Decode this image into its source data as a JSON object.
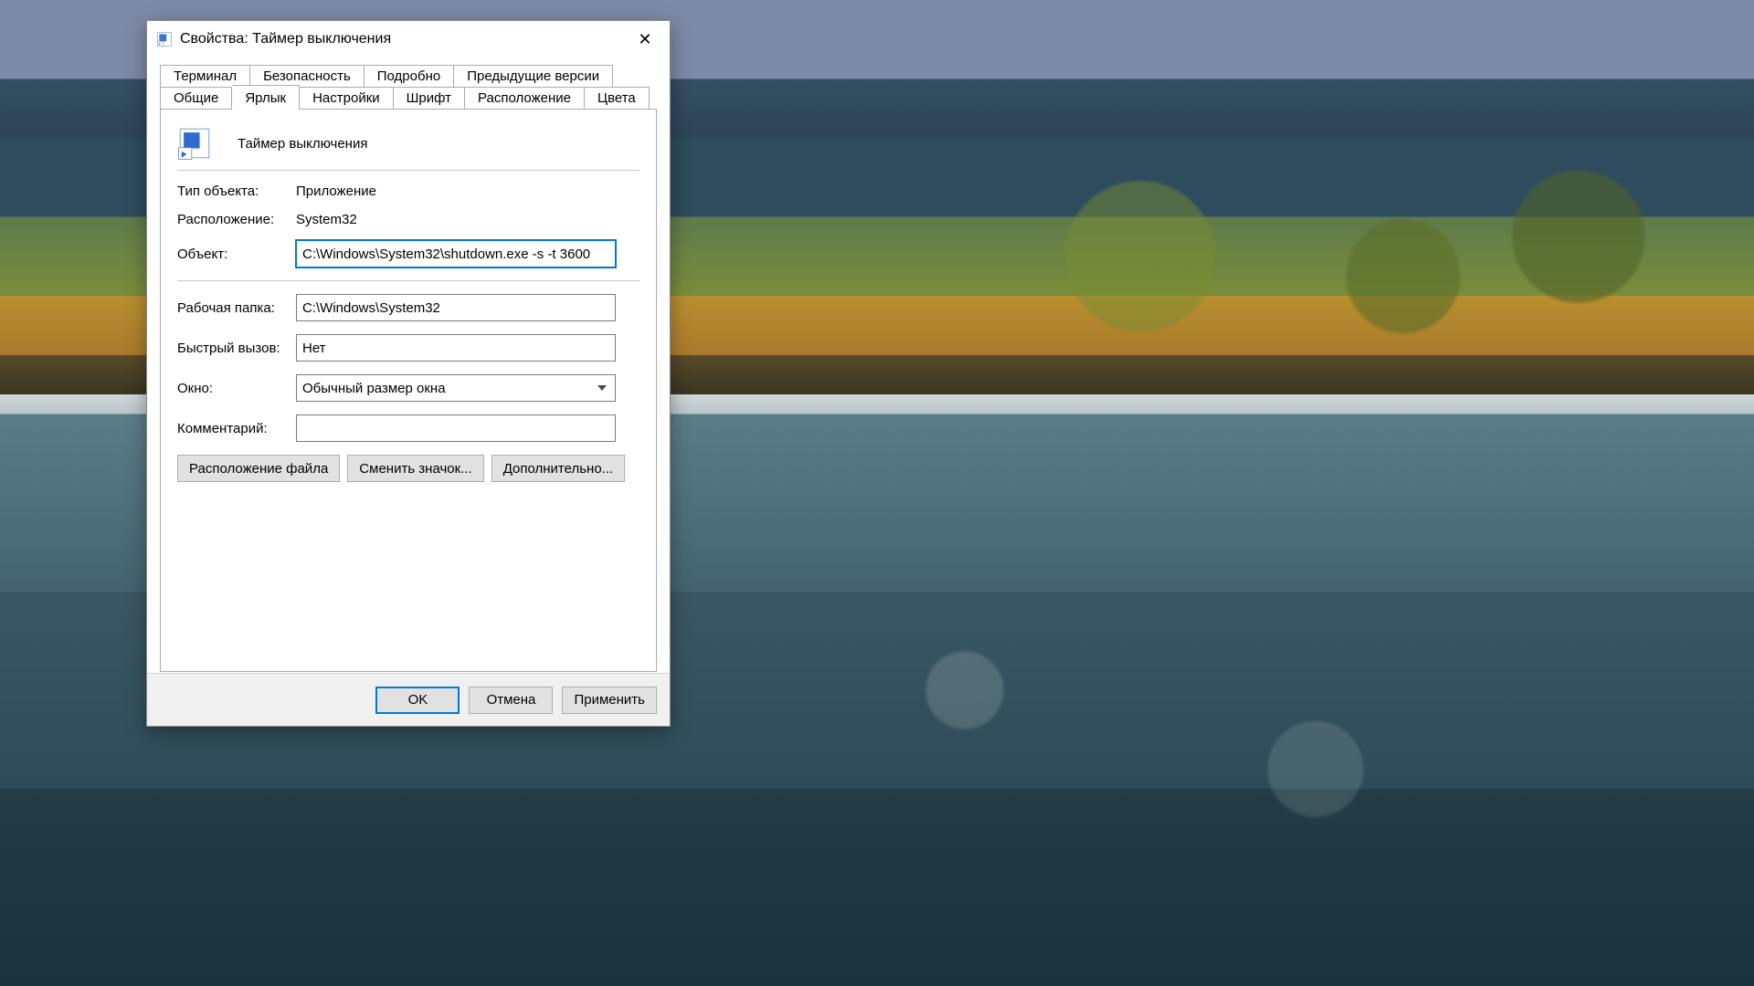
{
  "window": {
    "title": "Свойства: Таймер выключения",
    "close_glyph": "✕"
  },
  "tabs": {
    "row1": [
      "Терминал",
      "Безопасность",
      "Подробно",
      "Предыдущие версии"
    ],
    "row2": [
      "Общие",
      "Ярлык",
      "Настройки",
      "Шрифт",
      "Расположение",
      "Цвета"
    ],
    "active": "Ярлык"
  },
  "header": {
    "name": "Таймер выключения"
  },
  "fields": {
    "type_label": "Тип объекта:",
    "type_value": "Приложение",
    "location_label": "Расположение:",
    "location_value": "System32",
    "target_label": "Объект:",
    "target_value": "C:\\Windows\\System32\\shutdown.exe -s -t 3600",
    "startin_label": "Рабочая папка:",
    "startin_value": "C:\\Windows\\System32",
    "hotkey_label": "Быстрый вызов:",
    "hotkey_value": "Нет",
    "run_label": "Окно:",
    "run_value": "Обычный размер окна",
    "comment_label": "Комментарий:",
    "comment_value": ""
  },
  "panel_buttons": {
    "open_location": "Расположение файла",
    "change_icon": "Сменить значок...",
    "advanced": "Дополнительно..."
  },
  "footer": {
    "ok": "OK",
    "cancel": "Отмена",
    "apply": "Применить"
  }
}
